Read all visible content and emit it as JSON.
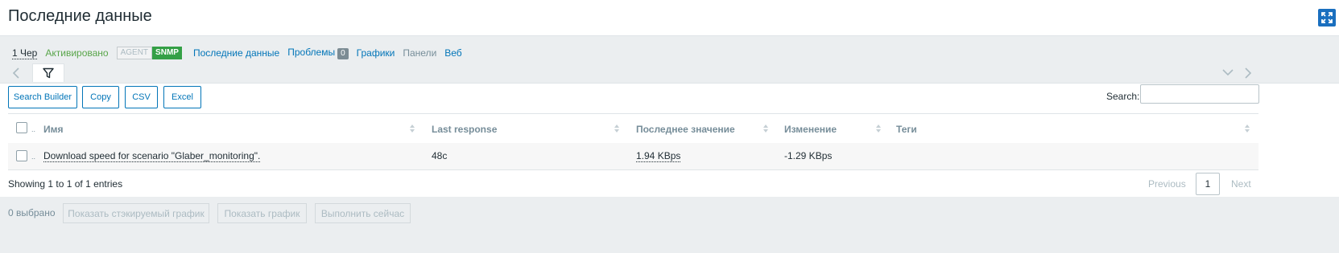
{
  "page": {
    "title": "Последние данные",
    "fullscreen_icon": "fullscreen-icon"
  },
  "hostbar": {
    "host": "1 Чер",
    "status": "Активировано",
    "badge_agent": "AGENT",
    "badge_snmp": "SNMP",
    "latest_data": "Последние данные",
    "problems": "Проблемы",
    "problems_count": "0",
    "graphs": "Графики",
    "dashboards": "Панели",
    "web": "Веб"
  },
  "toolbar": {
    "search_builder": "Search Builder",
    "copy": "Copy",
    "csv": "CSV",
    "excel": "Excel",
    "search_label": "Search:",
    "search_value": ""
  },
  "table": {
    "headers": [
      "Имя",
      "Last response",
      "Последнее значение",
      "Изменение",
      "Теги"
    ],
    "rows": [
      {
        "name": "Download speed for scenario \"Glaber_monitoring\".",
        "last_response": "48с",
        "last_value": "1.94 KBps",
        "change": "-1.29 KBps",
        "tags": ""
      }
    ]
  },
  "pagination": {
    "showing": "Showing 1 to 1 of 1 entries",
    "previous": "Previous",
    "current": "1",
    "next": "Next"
  },
  "footer": {
    "selected": "0 выбрано",
    "stacked_graph": "Показать стэкируемый график",
    "graph": "Показать график",
    "execute_now": "Выполнить сейчас"
  },
  "colors": {
    "accent": "#0275b8",
    "status_green": "#59a54a",
    "snmp_green": "#34a046",
    "background": "#ebeef0"
  }
}
